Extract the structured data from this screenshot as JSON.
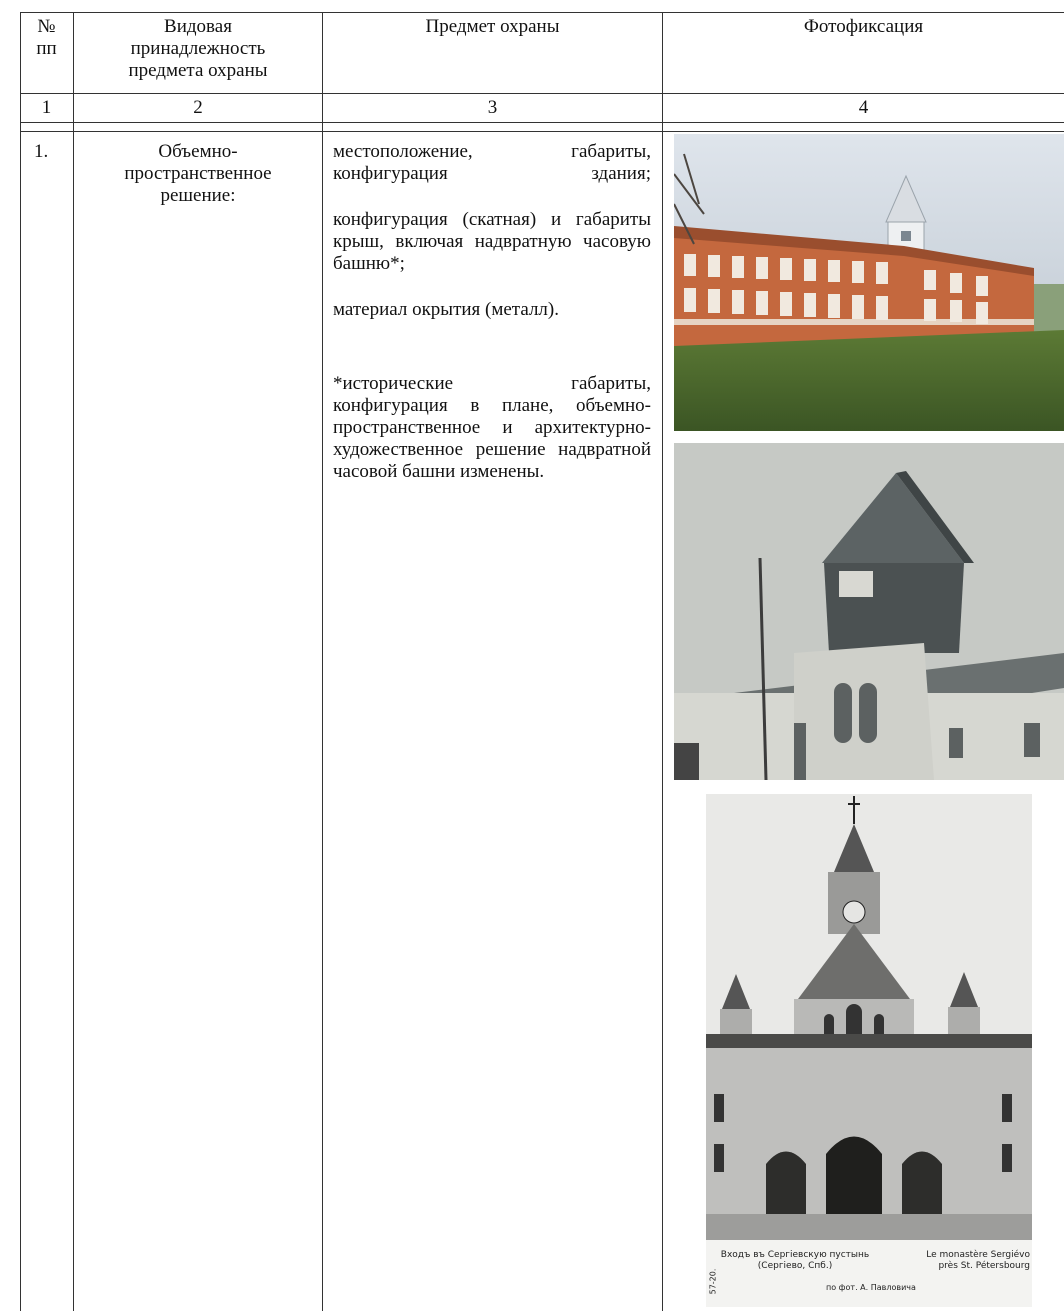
{
  "table": {
    "headers": {
      "num": "№\nпп",
      "type": "Видовая\nпринадлежность\nпредмета охраны",
      "subject": "Предмет охраны",
      "photo": "Фотофиксация"
    },
    "column_numbers": [
      "1",
      "2",
      "3",
      "4"
    ],
    "row": {
      "num": "1.",
      "type": "Объемно-\nпространственное\nрешение:",
      "subject_paragraphs": [
        "местоположение, габариты, конфигурация здания;",
        "конфигурация (скатная) и габариты крыш, включая надвратную часовую башню*;",
        "материал окрытия (металл).",
        "*исторические габариты, конфигурация в плане, объемно-пространственное и архитектурно-художественное решение надвратной часовой башни изменены."
      ]
    }
  },
  "photos": [
    {
      "icon": "photo-building-color"
    },
    {
      "icon": "photo-tower-historic"
    },
    {
      "icon": "photo-postcard-gate",
      "caption_left": "Входъ въ Сергіевскую пустынь\n(Сергіево, Спб.)",
      "caption_right": "Le monastère Sergiévo\nprès St. Pétersbourg",
      "caption_credit": "по фот. А. Павловича",
      "caption_code": "57-20."
    }
  ],
  "colors": {
    "border": "#333333",
    "brick": "#c4683e",
    "grass": "#4d6b2e",
    "sky": "#c9d3de"
  }
}
